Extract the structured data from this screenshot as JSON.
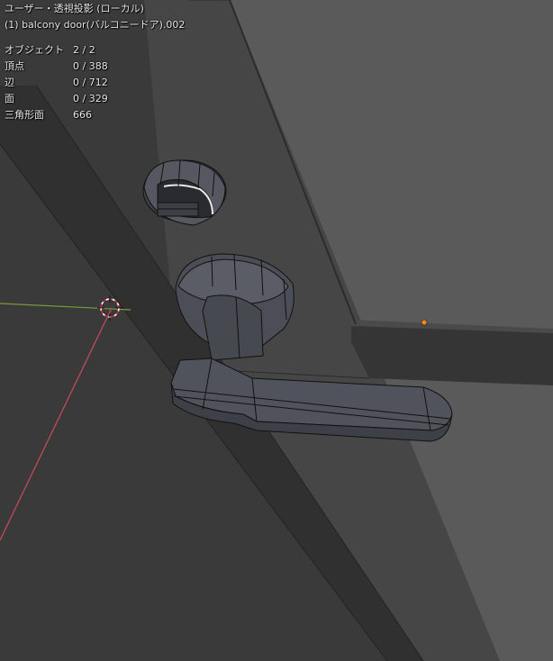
{
  "viewport": {
    "view_name": "ユーザー・透視投影 (ローカル)",
    "object_name": "(1) balcony door(バルコニードア).002"
  },
  "stats": [
    {
      "label": "オブジェクト",
      "value": "2 / 2"
    },
    {
      "label": "頂点",
      "value": "0 / 388"
    },
    {
      "label": "辺",
      "value": "0 / 712"
    },
    {
      "label": "面",
      "value": "0 / 329"
    },
    {
      "label": "三角形面",
      "value": "666"
    }
  ],
  "colors": {
    "background": "#3d3d3d",
    "wall": "#5a5a5a",
    "door_panel": "#464646",
    "door_frame": "#353535",
    "x_axis": "#c24a5a",
    "y_axis": "#7a9a38",
    "origin": "#f08a1a",
    "mesh": "#4e5057",
    "mesh_edge": "#111111"
  },
  "icons": {
    "cursor": "3d-cursor-icon"
  }
}
